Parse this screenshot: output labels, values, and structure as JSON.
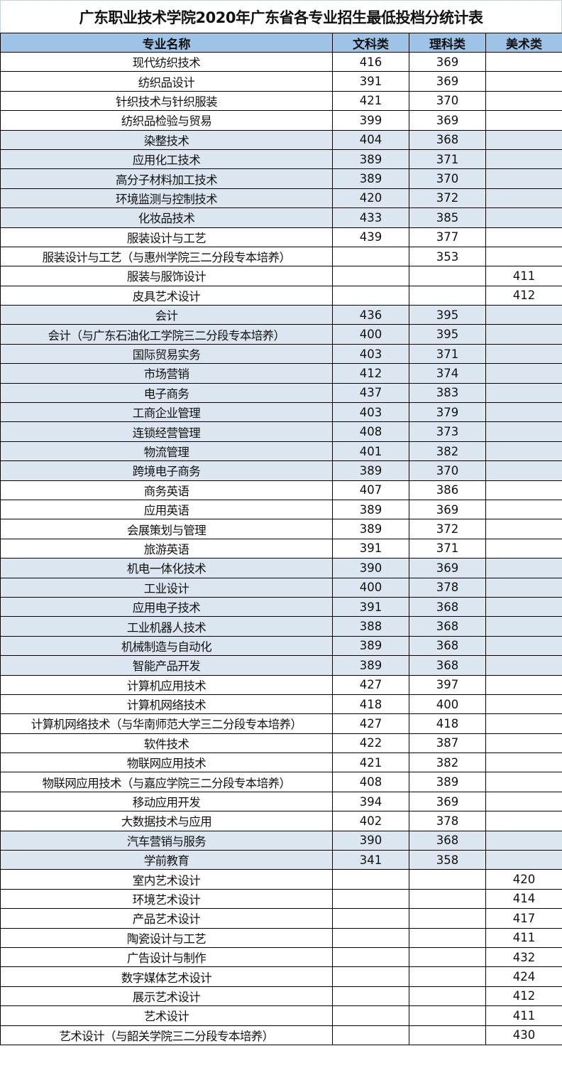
{
  "title": "广东职业技术学院2020年广东省各专业招生最低投档分统计表",
  "columns": [
    "专业名称",
    "文科类",
    "理科类",
    "美术类"
  ],
  "colors": {
    "header_bg": "#9dc3e6",
    "shaded_row_bg": "#dce6f1",
    "row_bg": "#ffffff"
  },
  "rows": [
    {
      "name": "现代纺织技术",
      "wen": "416",
      "li": "369",
      "mei": "",
      "shaded": false
    },
    {
      "name": "纺织品设计",
      "wen": "391",
      "li": "369",
      "mei": "",
      "shaded": false
    },
    {
      "name": "针织技术与针织服装",
      "wen": "421",
      "li": "370",
      "mei": "",
      "shaded": false
    },
    {
      "name": "纺织品检验与贸易",
      "wen": "399",
      "li": "369",
      "mei": "",
      "shaded": false
    },
    {
      "name": "染整技术",
      "wen": "404",
      "li": "368",
      "mei": "",
      "shaded": true
    },
    {
      "name": "应用化工技术",
      "wen": "389",
      "li": "371",
      "mei": "",
      "shaded": true
    },
    {
      "name": "高分子材料加工技术",
      "wen": "389",
      "li": "370",
      "mei": "",
      "shaded": true
    },
    {
      "name": "环境监测与控制技术",
      "wen": "420",
      "li": "372",
      "mei": "",
      "shaded": true
    },
    {
      "name": "化妆品技术",
      "wen": "433",
      "li": "385",
      "mei": "",
      "shaded": true
    },
    {
      "name": "服装设计与工艺",
      "wen": "439",
      "li": "377",
      "mei": "",
      "shaded": false
    },
    {
      "name": "服装设计与工艺（与惠州学院三二分段专本培养）",
      "wen": "",
      "li": "353",
      "mei": "",
      "shaded": false
    },
    {
      "name": "服装与服饰设计",
      "wen": "",
      "li": "",
      "mei": "411",
      "shaded": false
    },
    {
      "name": "皮具艺术设计",
      "wen": "",
      "li": "",
      "mei": "412",
      "shaded": false
    },
    {
      "name": "会计",
      "wen": "436",
      "li": "395",
      "mei": "",
      "shaded": true
    },
    {
      "name": "会计（与广东石油化工学院三二分段专本培养）",
      "wen": "400",
      "li": "395",
      "mei": "",
      "shaded": true
    },
    {
      "name": "国际贸易实务",
      "wen": "403",
      "li": "371",
      "mei": "",
      "shaded": true
    },
    {
      "name": "市场营销",
      "wen": "412",
      "li": "374",
      "mei": "",
      "shaded": true
    },
    {
      "name": "电子商务",
      "wen": "437",
      "li": "383",
      "mei": "",
      "shaded": true
    },
    {
      "name": "工商企业管理",
      "wen": "403",
      "li": "379",
      "mei": "",
      "shaded": true
    },
    {
      "name": "连锁经营管理",
      "wen": "408",
      "li": "373",
      "mei": "",
      "shaded": true
    },
    {
      "name": "物流管理",
      "wen": "401",
      "li": "382",
      "mei": "",
      "shaded": true
    },
    {
      "name": "跨境电子商务",
      "wen": "389",
      "li": "370",
      "mei": "",
      "shaded": true
    },
    {
      "name": "商务英语",
      "wen": "407",
      "li": "386",
      "mei": "",
      "shaded": false
    },
    {
      "name": "应用英语",
      "wen": "389",
      "li": "369",
      "mei": "",
      "shaded": false
    },
    {
      "name": "会展策划与管理",
      "wen": "389",
      "li": "372",
      "mei": "",
      "shaded": false
    },
    {
      "name": "旅游英语",
      "wen": "391",
      "li": "371",
      "mei": "",
      "shaded": false
    },
    {
      "name": "机电一体化技术",
      "wen": "390",
      "li": "369",
      "mei": "",
      "shaded": true
    },
    {
      "name": "工业设计",
      "wen": "400",
      "li": "378",
      "mei": "",
      "shaded": true
    },
    {
      "name": "应用电子技术",
      "wen": "391",
      "li": "368",
      "mei": "",
      "shaded": true
    },
    {
      "name": "工业机器人技术",
      "wen": "388",
      "li": "368",
      "mei": "",
      "shaded": true
    },
    {
      "name": "机械制造与自动化",
      "wen": "389",
      "li": "368",
      "mei": "",
      "shaded": true
    },
    {
      "name": "智能产品开发",
      "wen": "389",
      "li": "368",
      "mei": "",
      "shaded": true
    },
    {
      "name": "计算机应用技术",
      "wen": "427",
      "li": "397",
      "mei": "",
      "shaded": false
    },
    {
      "name": "计算机网络技术",
      "wen": "418",
      "li": "400",
      "mei": "",
      "shaded": false
    },
    {
      "name": "计算机网络技术（与华南师范大学三二分段专本培养）",
      "wen": "427",
      "li": "418",
      "mei": "",
      "shaded": false
    },
    {
      "name": "软件技术",
      "wen": "422",
      "li": "387",
      "mei": "",
      "shaded": false
    },
    {
      "name": "物联网应用技术",
      "wen": "421",
      "li": "382",
      "mei": "",
      "shaded": false
    },
    {
      "name": "物联网应用技术（与嘉应学院三二分段专本培养）",
      "wen": "408",
      "li": "389",
      "mei": "",
      "shaded": false
    },
    {
      "name": "移动应用开发",
      "wen": "394",
      "li": "369",
      "mei": "",
      "shaded": false
    },
    {
      "name": "大数据技术与应用",
      "wen": "402",
      "li": "378",
      "mei": "",
      "shaded": false
    },
    {
      "name": "汽车营销与服务",
      "wen": "390",
      "li": "368",
      "mei": "",
      "shaded": true
    },
    {
      "name": "学前教育",
      "wen": "341",
      "li": "358",
      "mei": "",
      "shaded": true
    },
    {
      "name": "室内艺术设计",
      "wen": "",
      "li": "",
      "mei": "420",
      "shaded": false
    },
    {
      "name": "环境艺术设计",
      "wen": "",
      "li": "",
      "mei": "414",
      "shaded": false
    },
    {
      "name": "产品艺术设计",
      "wen": "",
      "li": "",
      "mei": "417",
      "shaded": false
    },
    {
      "name": "陶瓷设计与工艺",
      "wen": "",
      "li": "",
      "mei": "411",
      "shaded": false
    },
    {
      "name": "广告设计与制作",
      "wen": "",
      "li": "",
      "mei": "432",
      "shaded": false
    },
    {
      "name": "数字媒体艺术设计",
      "wen": "",
      "li": "",
      "mei": "424",
      "shaded": false
    },
    {
      "name": "展示艺术设计",
      "wen": "",
      "li": "",
      "mei": "412",
      "shaded": false
    },
    {
      "name": "艺术设计",
      "wen": "",
      "li": "",
      "mei": "411",
      "shaded": false
    },
    {
      "name": "艺术设计（与韶关学院三二分段专本培养）",
      "wen": "",
      "li": "",
      "mei": "430",
      "shaded": false
    }
  ]
}
